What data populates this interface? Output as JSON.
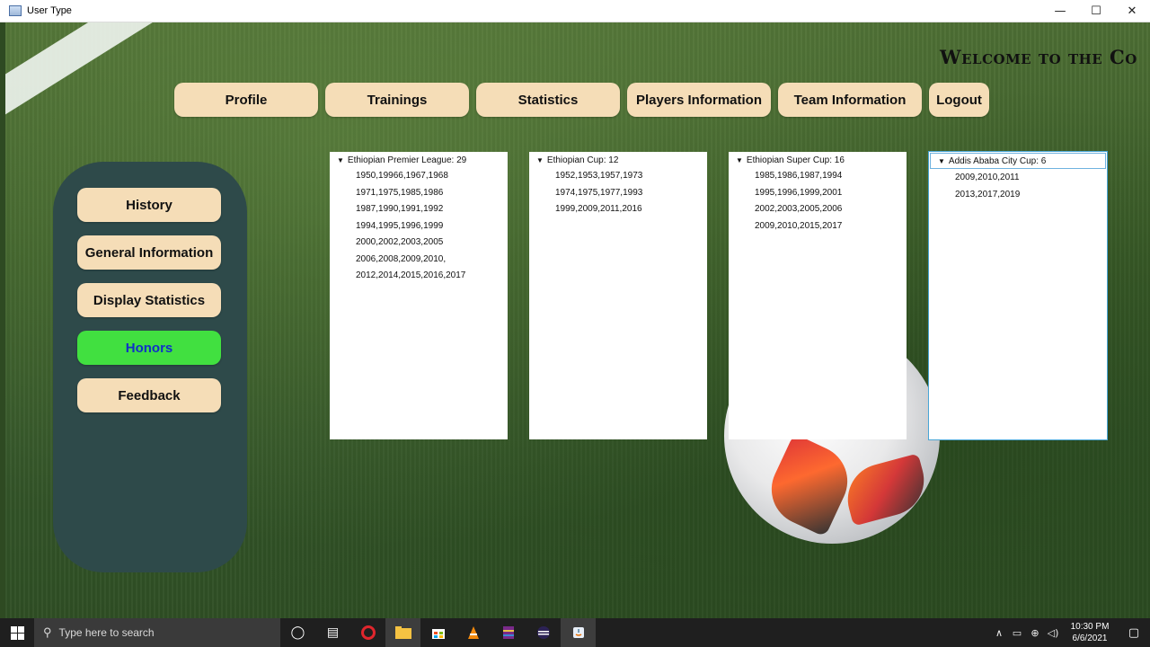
{
  "window": {
    "title": "User Type",
    "controls": {
      "minimize": "—",
      "maximize": "☐",
      "close": "✕"
    }
  },
  "welcome_text": "Welcome to the Co",
  "top_nav": [
    {
      "label": "Profile"
    },
    {
      "label": "Trainings"
    },
    {
      "label": "Statistics"
    },
    {
      "label": "Players Information"
    },
    {
      "label": "Team Information"
    },
    {
      "label": "Logout"
    }
  ],
  "side_menu": [
    {
      "label": "History",
      "active": false
    },
    {
      "label": "General Information",
      "active": false
    },
    {
      "label": "Display Statistics",
      "active": false
    },
    {
      "label": "Honors",
      "active": true
    },
    {
      "label": "Feedback",
      "active": false
    }
  ],
  "honors": [
    {
      "root": "Ethiopian Premier League: 29",
      "items": [
        "1950,19966,1967,1968",
        "1971,1975,1985,1986",
        "1987,1990,1991,1992",
        "1994,1995,1996,1999",
        "2000,2002,2003,2005",
        "2006,2008,2009,2010,",
        "2012,2014,2015,2016,2017"
      ]
    },
    {
      "root": "Ethiopian Cup: 12",
      "items": [
        "1952,1953,1957,1973",
        "1974,1975,1977,1993",
        "1999,2009,2011,2016"
      ]
    },
    {
      "root": "Ethiopian Super Cup: 16",
      "items": [
        "1985,1986,1987,1994",
        "1995,1996,1999,2001",
        "2002,2003,2005,2006",
        "2009,2010,2015,2017"
      ]
    },
    {
      "root": "Addis Ababa City Cup: 6",
      "items": [
        "2009,2010,2011",
        "2013,2017,2019"
      ]
    }
  ],
  "taskbar": {
    "search_placeholder": "Type here to search",
    "time": "10:30 PM",
    "date": "6/6/2021",
    "apps": [
      "cortana-icon",
      "task-view-icon",
      "opera-icon",
      "file-explorer-icon",
      "store-icon",
      "vlc-icon",
      "winrar-icon",
      "eclipse-icon",
      "java-icon"
    ]
  },
  "colors": {
    "button_bg": "#f5ddb7",
    "active_button_bg": "#41e040",
    "active_button_text": "#1030c8",
    "side_panel_bg": "#2e4a4a"
  }
}
